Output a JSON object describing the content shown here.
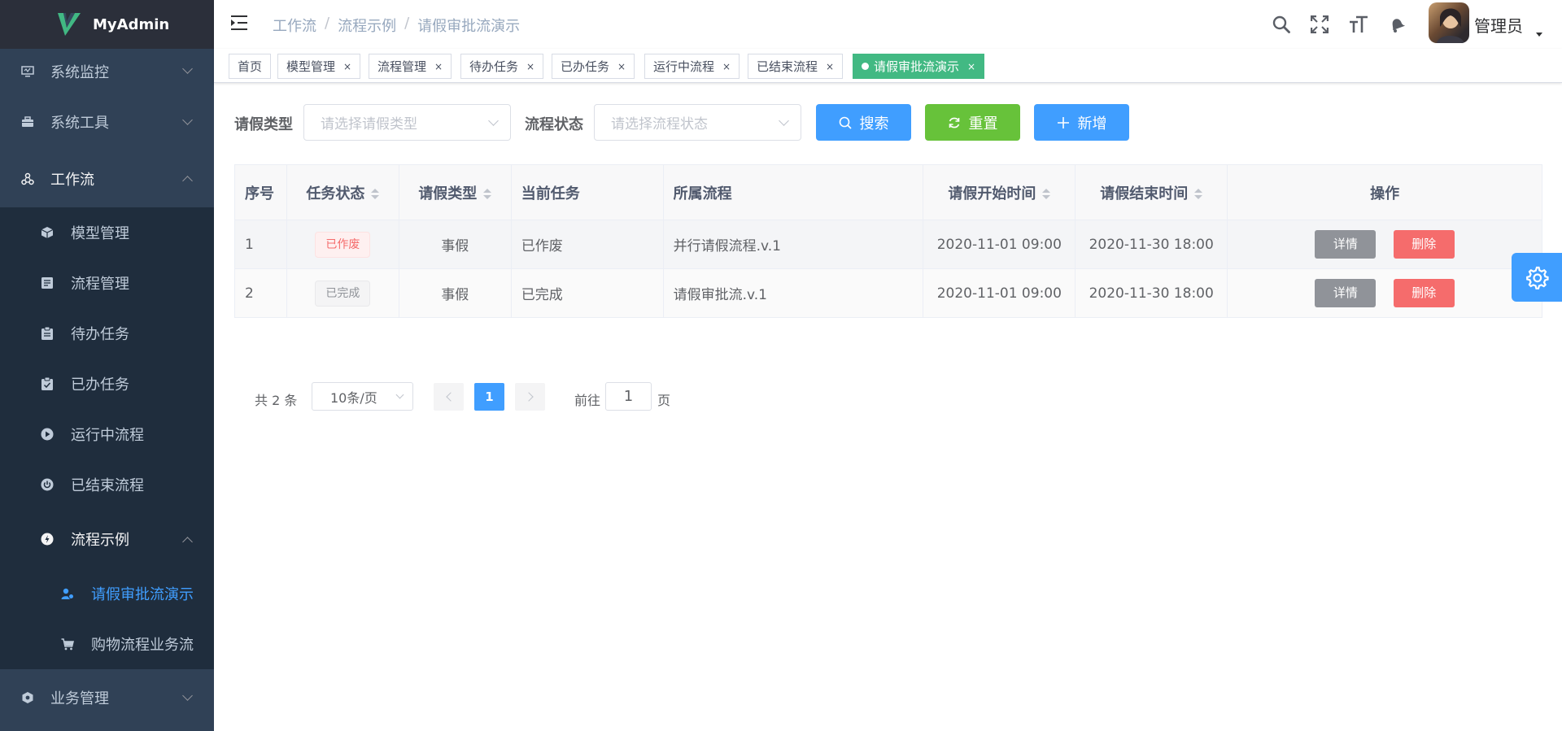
{
  "app": {
    "name": "MyAdmin"
  },
  "sidebar": {
    "items": [
      {
        "label": "系统监控",
        "icon": "monitor-icon"
      },
      {
        "label": "系统工具",
        "icon": "toolbox-icon"
      },
      {
        "label": "工作流",
        "icon": "workflow-icon"
      }
    ],
    "workflow_children": [
      {
        "label": "模型管理",
        "icon": "cube-icon"
      },
      {
        "label": "流程管理",
        "icon": "list-icon"
      },
      {
        "label": "待办任务",
        "icon": "clipboard-icon"
      },
      {
        "label": "已办任务",
        "icon": "clipboard-check-icon"
      },
      {
        "label": "运行中流程",
        "icon": "play-icon"
      },
      {
        "label": "已结束流程",
        "icon": "power-icon"
      },
      {
        "label": "流程示例",
        "icon": "compass-icon"
      }
    ],
    "example_children": [
      {
        "label": "请假审批流演示",
        "icon": "user-flow-icon"
      },
      {
        "label": "购物流程业务流",
        "icon": "cart-icon"
      }
    ],
    "business": {
      "label": "业务管理",
      "icon": "cog-cube-icon"
    }
  },
  "navbar": {
    "breadcrumb": [
      "工作流",
      "流程示例",
      "请假审批流演示"
    ],
    "user_name": "管理员"
  },
  "tags": [
    {
      "label": "首页",
      "closable": false,
      "active": false
    },
    {
      "label": "模型管理",
      "closable": true,
      "active": false
    },
    {
      "label": "流程管理",
      "closable": true,
      "active": false
    },
    {
      "label": "待办任务",
      "closable": true,
      "active": false
    },
    {
      "label": "已办任务",
      "closable": true,
      "active": false
    },
    {
      "label": "运行中流程",
      "closable": true,
      "active": false
    },
    {
      "label": "已结束流程",
      "closable": true,
      "active": false
    },
    {
      "label": "请假审批流演示",
      "closable": true,
      "active": true
    }
  ],
  "tag_close_glyph": "×",
  "search": {
    "leave_type_label": "请假类型",
    "leave_type_placeholder": "请选择请假类型",
    "status_label": "流程状态",
    "status_placeholder": "请选择流程状态",
    "search_button": "搜索",
    "reset_button": "重置",
    "add_button": "新增"
  },
  "table": {
    "columns": [
      "序号",
      "任务状态",
      "请假类型",
      "当前任务",
      "所属流程",
      "请假开始时间",
      "请假结束时间",
      "操作"
    ],
    "rows": [
      {
        "index": "1",
        "status": "已作废",
        "leave_type": "事假",
        "current_task": "已作废",
        "process": "并行请假流程.v.1",
        "start": "2020-11-01 09:00",
        "end": "2020-11-30 18:00",
        "detail": "详情",
        "delete": "删除"
      },
      {
        "index": "2",
        "status": "已完成",
        "leave_type": "事假",
        "current_task": "已完成",
        "process": "请假审批流.v.1",
        "start": "2020-11-01 09:00",
        "end": "2020-11-30 18:00",
        "detail": "详情",
        "delete": "删除"
      }
    ]
  },
  "pagination": {
    "total": "共 2 条",
    "page_size": "10条/页",
    "current_page": "1",
    "goto_prefix": "前往",
    "goto_value": "1",
    "goto_suffix": "页"
  },
  "colors": {
    "sidebar_bg": "#304156",
    "submenu_bg": "#1f2d3d",
    "primary": "#409eff",
    "success": "#67c23a",
    "danger": "#f56c6c",
    "active_tag": "#42b983"
  }
}
